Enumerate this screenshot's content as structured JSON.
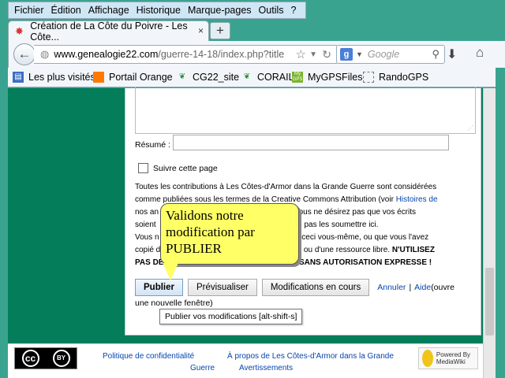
{
  "menubar": {
    "items": [
      "Fichier",
      "Édition",
      "Affichage",
      "Historique",
      "Marque-pages",
      "Outils",
      "?"
    ]
  },
  "tab": {
    "title": "Création de La Côte du Poivre - Les Côte...",
    "close": "×",
    "newtab": "+"
  },
  "navbar": {
    "url_domain": "www.genealogie22.com",
    "url_path": "/guerre-14-18/index.php?title",
    "search_placeholder": "Google"
  },
  "bookmarks": [
    "Les plus visités",
    "Portail Orange",
    "CG22_site",
    "CORAIL",
    "MyGPSFiles",
    "RandoGPS"
  ],
  "form": {
    "resume_label": "Résumé :",
    "watch_label": "Suivre cette page",
    "legal_line1": "Toutes les contributions à Les Côtes-d'Armor dans la Grande Guerre sont considérées",
    "legal_line2a": "comme publiées sous les termes de la Creative Commons Attribution (voir ",
    "legal_link": "Histoires de",
    "legal_line3a": "nos an",
    "legal_line3b": "). Si vous ne désirez pas que vos écrits",
    "legal_line4a": "soient",
    "legal_line4b": "si de ne pas les soumettre ici.",
    "legal_line5a": "Vous n",
    "legal_line5b": "écrit ceci vous-même, ou que vous l'avez",
    "legal_line6a": "copié d",
    "legal_line6b": "public, ou d'une ressource libre. ",
    "legal_line6c": "N'UTILISEZ",
    "legal_line7": "PAS DE TRAVAUX SOUS DROIT D'AUTEUR SANS AUTORISATION EXPRESSE !",
    "publish": "Publier",
    "preview": "Prévisualiser",
    "changes": "Modifications en cours",
    "cancel": "Annuler",
    "sep": "|",
    "help": "Aide",
    "help_suffix": " (ouvre",
    "newwin": "une nouvelle fenêtre)"
  },
  "tooltip": "Publier vos modifications [alt-shift-s]",
  "callout": {
    "line1": "Validons notre",
    "line2": "modification par",
    "line3": "PUBLIER"
  },
  "footer": {
    "privacy": "Politique de confidentialité",
    "about": "À propos de Les Côtes-d'Armor dans la Grande",
    "guerre": "Guerre",
    "disclaimers": "Avertissements",
    "cc": "cc",
    "by": "BY",
    "mediawiki": "Powered By MediaWiki"
  }
}
